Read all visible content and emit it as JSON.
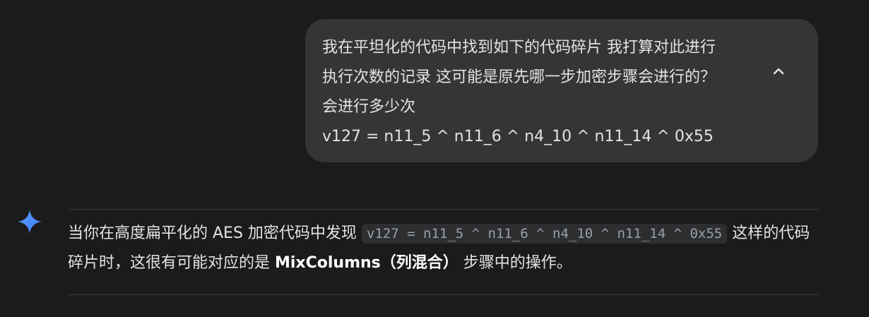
{
  "user_message": {
    "lines": [
      "我在平坦化的代码中找到如下的代码碎片 我打算对此进行",
      "执行次数的记录 这可能是原先哪一步加密步骤会进行的？",
      "会进行多少次",
      "v127 = n11_5 ^ n11_6 ^ n4_10 ^ n11_14 ^ 0x55"
    ]
  },
  "model_response": {
    "text_before": "当你在高度扁平化的 AES 加密代码中发现 ",
    "code": "v127 = n11_5 ^ n11_6 ^ n4_10 ^ n11_14 ^ 0x55",
    "text_after_code": " 这样的代码碎片时，这很有可能对应的是 ",
    "bold": "MixColumns（列混合）",
    "text_end": " 步骤中的操作。"
  },
  "colors": {
    "background": "#1b1b1c",
    "bubble": "#333537",
    "text": "#e3e3e3",
    "sparkle": "#4a8cf7"
  },
  "icons": {
    "collapse": "chevron-up-icon",
    "assistant": "sparkle-icon"
  }
}
